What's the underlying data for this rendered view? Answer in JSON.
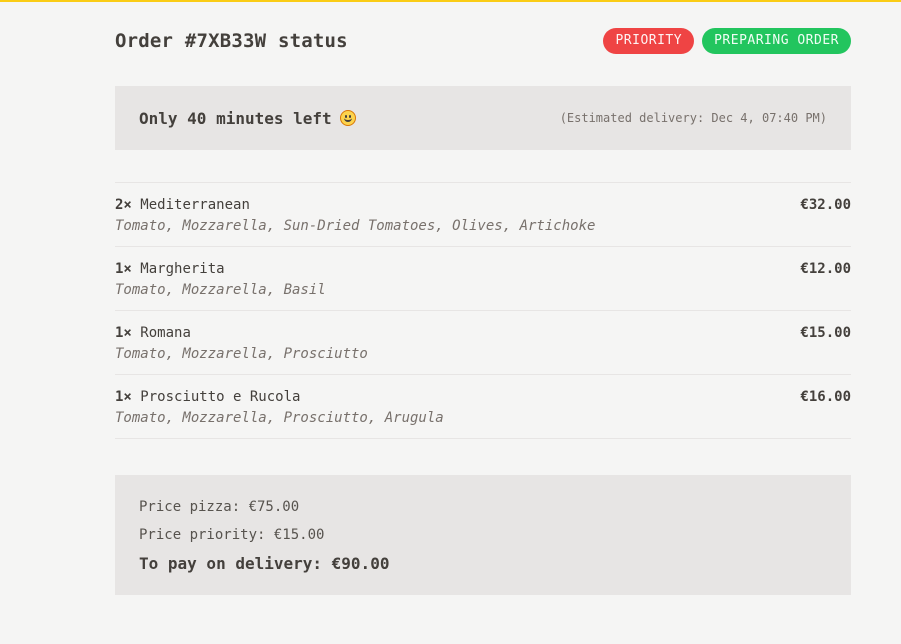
{
  "order": {
    "title": "Order #7XB33W status",
    "badges": {
      "priority": "PRIORITY",
      "status": "PREPARING ORDER"
    },
    "time_left": "Only 40 minutes left",
    "time_left_icon": "smiling-face-icon",
    "estimated_delivery": "(Estimated delivery: Dec 4, 07:40 PM)"
  },
  "items": [
    {
      "qty": "2×",
      "name": "Mediterranean",
      "price": "€32.00",
      "ingredients": "Tomato, Mozzarella, Sun-Dried Tomatoes, Olives, Artichoke"
    },
    {
      "qty": "1×",
      "name": "Margherita",
      "price": "€12.00",
      "ingredients": "Tomato, Mozzarella, Basil"
    },
    {
      "qty": "1×",
      "name": "Romana",
      "price": "€15.00",
      "ingredients": "Tomato, Mozzarella, Prosciutto"
    },
    {
      "qty": "1×",
      "name": "Prosciutto e Rucola",
      "price": "€16.00",
      "ingredients": "Tomato, Mozzarella, Prosciutto, Arugula"
    }
  ],
  "summary": {
    "price_pizza": "Price pizza: €75.00",
    "price_priority": "Price priority: €15.00",
    "to_pay": "To pay on delivery: €90.00"
  },
  "colors": {
    "accent_bar": "#facc15",
    "priority_badge": "#ef4444",
    "status_badge": "#22c55e",
    "panel_background": "#e7e5e4",
    "page_background": "#f5f5f4"
  }
}
